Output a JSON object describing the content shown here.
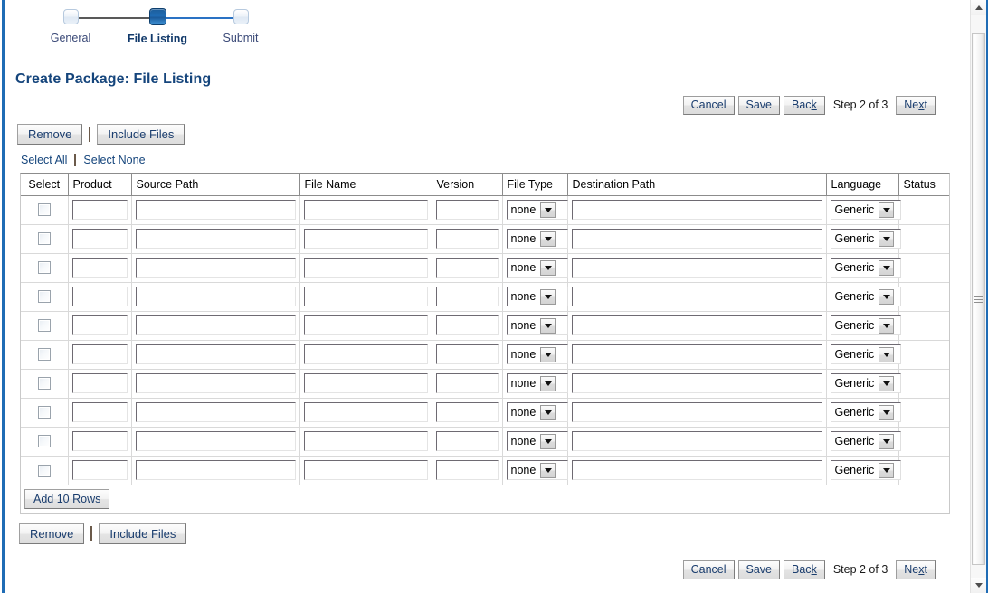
{
  "train": {
    "steps": [
      {
        "label": "General",
        "state": "pending"
      },
      {
        "label": "File Listing",
        "state": "current"
      },
      {
        "label": "Submit",
        "state": "pending"
      }
    ]
  },
  "page_title": "Create Package: File Listing",
  "toolbar": {
    "cancel_label": "Cancel",
    "save_label": "Save",
    "back_label": "Bac",
    "back_accesskey": "k",
    "step_text": "Step 2 of 3",
    "next_label": "Ne",
    "next_accesskey": "x",
    "next_label_tail": "t"
  },
  "actions": {
    "remove_label": "Remove",
    "include_files_label": "Include Files"
  },
  "select_links": {
    "select_all_label": "Select All",
    "select_none_label": "Select None"
  },
  "table": {
    "headers": [
      "Select",
      "Product",
      "Source Path",
      "File Name",
      "Version",
      "File Type",
      "Destination Path",
      "Language",
      "Status"
    ],
    "row_count": 10,
    "defaults": {
      "product": "",
      "source_path": "",
      "file_name": "",
      "version": "",
      "file_type": "none",
      "destination_path": "",
      "language": "Generic",
      "status": "",
      "selected": false
    },
    "file_type_options": [
      "none"
    ],
    "language_options": [
      "Generic"
    ],
    "add_rows_label": "Add 10 Rows"
  },
  "colors": {
    "accent_blue": "#1f6cb5",
    "title_blue": "#15457c",
    "link_blue": "#15457c",
    "train_done_line": "#595959",
    "train_todo_line": "#2a72c4"
  },
  "scrollbar": {
    "up_icon": "scroll-up-arrow",
    "down_icon": "scroll-down-arrow"
  }
}
